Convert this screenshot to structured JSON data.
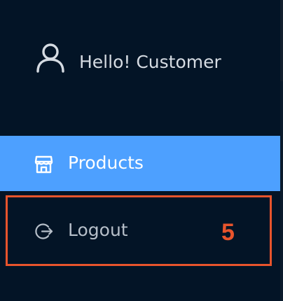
{
  "header": {
    "greeting": "Hello! Customer",
    "avatar_icon": "user-icon"
  },
  "nav": {
    "items": [
      {
        "label": "Products",
        "icon": "store-icon",
        "active": true
      },
      {
        "label": "Logout",
        "icon": "logout-icon",
        "active": false
      }
    ]
  },
  "annotation": {
    "step_number": "5",
    "color": "#e8542c"
  },
  "colors": {
    "background": "#031426",
    "active_item": "#4da0ff",
    "text": "#d5dbe2",
    "muted_text": "#b6bfc9"
  }
}
